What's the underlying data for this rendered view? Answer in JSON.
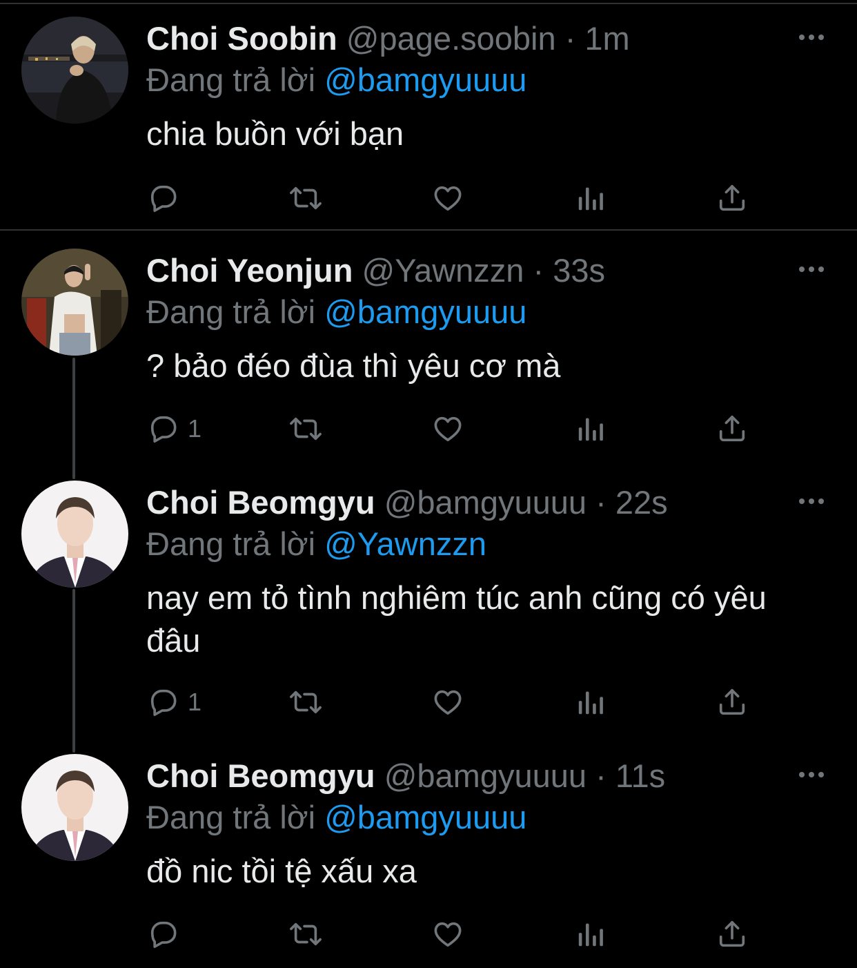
{
  "replying_prefix": "Đang trả lời",
  "colors": {
    "background": "#000000",
    "text": "#e7e9ea",
    "secondary": "#71767b",
    "accent": "#1d9bf0",
    "divider": "#2f3336"
  },
  "tweets": [
    {
      "name": "Choi Soobin",
      "handle": "@page.soobin",
      "separator": "·",
      "time": "1m",
      "replying_to": "@bamgyuuuu",
      "text": "chia buồn với bạn",
      "reply_count": "",
      "avatar": "night-city-photo"
    },
    {
      "name": "Choi Yeonjun",
      "handle": "@Yawnzzn",
      "separator": "·",
      "time": "33s",
      "replying_to": "@bamgyuuuu",
      "text": "? bảo đéo đùa thì yêu cơ mà",
      "reply_count": "1",
      "avatar": "mirror-selfie-photo"
    },
    {
      "name": "Choi Beomgyu",
      "handle": "@bamgyuuuu",
      "separator": "·",
      "time": "22s",
      "replying_to": "@Yawnzzn",
      "text": "nay em tỏ tình nghiêm túc anh cũng có yêu đâu",
      "reply_count": "1",
      "avatar": "formal-portrait-photo"
    },
    {
      "name": "Choi Beomgyu",
      "handle": "@bamgyuuuu",
      "separator": "·",
      "time": "11s",
      "replying_to": "@bamgyuuuu",
      "text": "đồ nic tồi tệ xấu xa",
      "reply_count": "",
      "avatar": "formal-portrait-photo"
    }
  ],
  "icons": [
    "reply-icon",
    "retweet-icon",
    "like-icon",
    "analytics-icon",
    "share-icon",
    "more-options-icon"
  ]
}
